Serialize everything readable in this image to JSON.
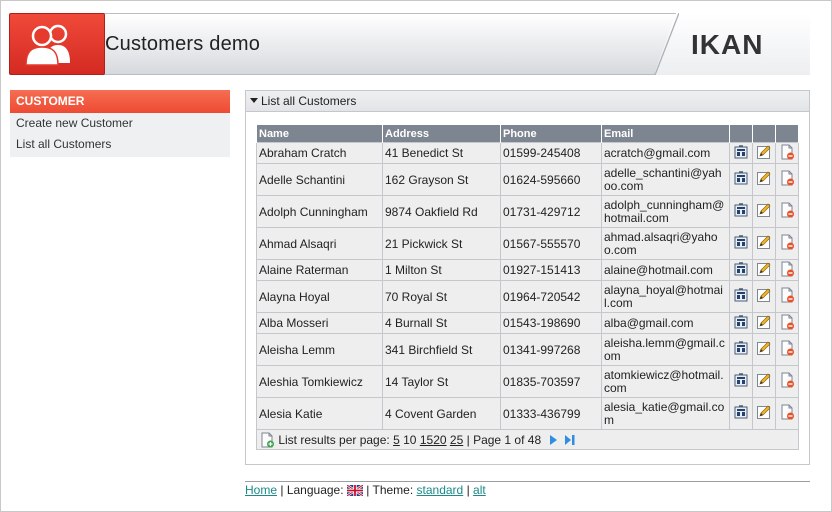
{
  "header": {
    "title": "Customers demo",
    "brand": "IKAN"
  },
  "sidebar": {
    "heading": "CUSTOMER",
    "items": [
      {
        "label": "Create new Customer"
      },
      {
        "label": "List all Customers"
      }
    ]
  },
  "panel": {
    "title": "List all Customers",
    "columns": [
      "Name",
      "Address",
      "Phone",
      "Email"
    ],
    "rows": [
      {
        "name": "Abraham Cratch",
        "address": "41 Benedict St",
        "phone": "01599-245408",
        "email": [
          "acratch@gmail.com"
        ]
      },
      {
        "name": "Adelle Schantini",
        "address": "162 Grayson St",
        "phone": "01624-595660",
        "email": [
          "adelle_schantini@yah",
          "oo.com"
        ]
      },
      {
        "name": "Adolph Cunningham",
        "address": "9874 Oakfield Rd",
        "phone": "01731-429712",
        "email": [
          "adolph_cunningham@",
          "hotmail.com"
        ]
      },
      {
        "name": "Ahmad Alsaqri",
        "address": "21 Pickwick St",
        "phone": "01567-555570",
        "email": [
          "ahmad.alsaqri@yaho",
          "o.com"
        ]
      },
      {
        "name": "Alaine Raterman",
        "address": "1 Milton St",
        "phone": "01927-151413",
        "email": [
          "alaine@hotmail.com"
        ]
      },
      {
        "name": "Alayna Hoyal",
        "address": "70 Royal St",
        "phone": "01964-720542",
        "email": [
          "alayna_hoyal@hotmai",
          "l.com"
        ]
      },
      {
        "name": "Alba Mosseri",
        "address": "4 Burnall St",
        "phone": "01543-198690",
        "email": [
          "alba@gmail.com"
        ]
      },
      {
        "name": "Aleisha Lemm",
        "address": "341 Birchfield St",
        "phone": "01341-997268",
        "email": [
          "aleisha.lemm@gmail.c",
          "om"
        ]
      },
      {
        "name": "Aleshia Tomkiewicz",
        "address": "14 Taylor St",
        "phone": "01835-703597",
        "email": [
          "atomkiewicz@hotmail.",
          "com"
        ]
      },
      {
        "name": "Alesia Katie",
        "address": "4 Covent Garden",
        "phone": "01333-436799",
        "email": [
          "alesia_katie@gmail.co",
          "m"
        ]
      }
    ],
    "row_heights": [
      21,
      32,
      32,
      32,
      21,
      32,
      21,
      32,
      32,
      32
    ],
    "pager": {
      "label": "List results per page:",
      "sizes": [
        "5",
        "10",
        "15",
        "20",
        "25"
      ],
      "current_size": "10",
      "sep": "|",
      "page_text": "Page 1 of 48"
    }
  },
  "footer": {
    "home": "Home",
    "sep1": "|",
    "language_label": "Language:",
    "sep2": "|",
    "theme_label": "Theme:",
    "theme_standard": "standard",
    "sep3": "|",
    "theme_alt": "alt"
  }
}
